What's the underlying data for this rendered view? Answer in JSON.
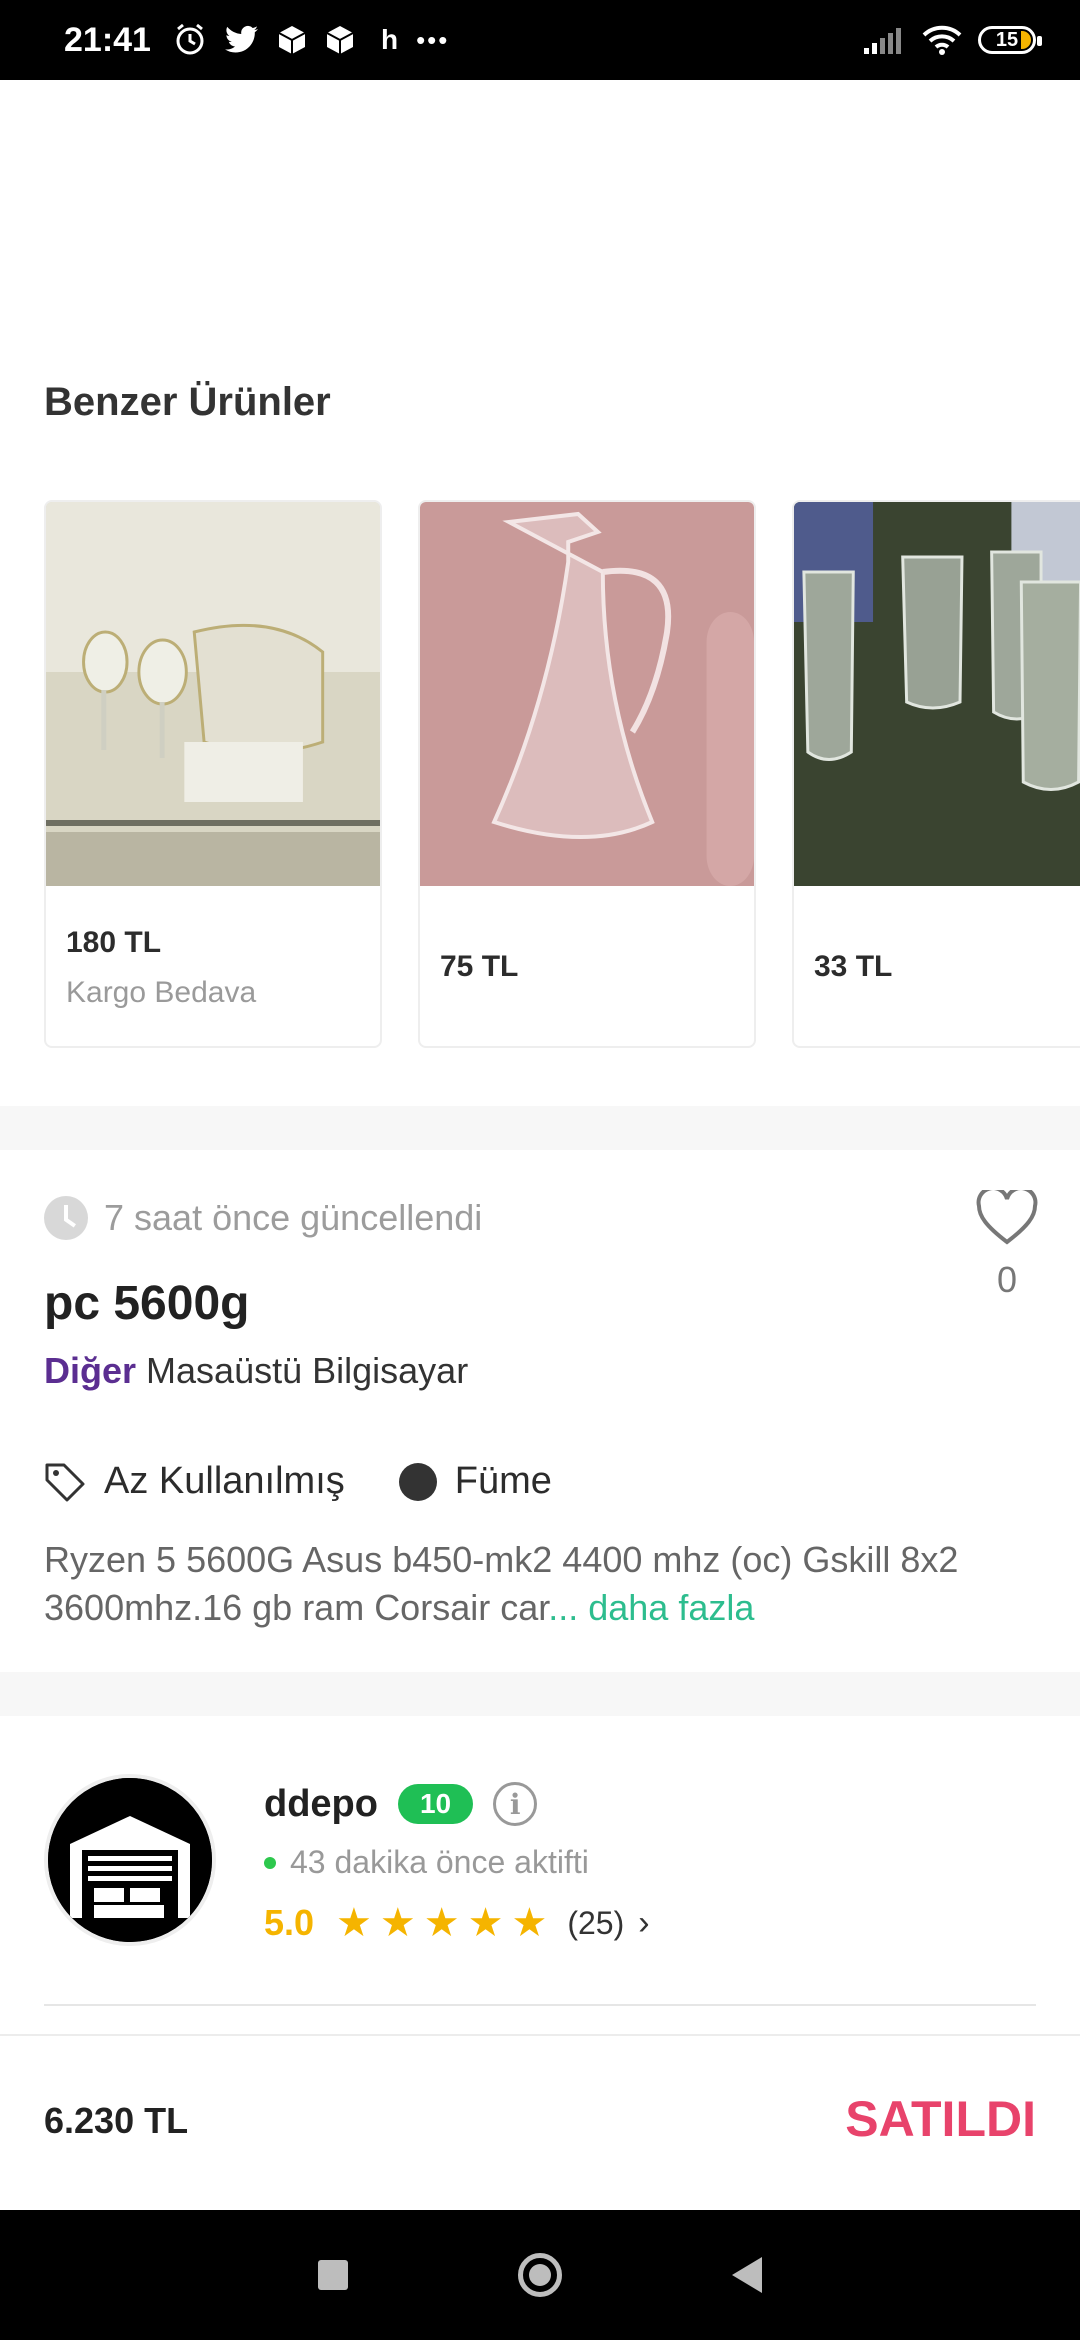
{
  "status_bar": {
    "time": "21:41",
    "extra_label": "h",
    "more_dots": "•••",
    "battery": "15"
  },
  "similar": {
    "title": "Benzer Ürünler",
    "items": [
      {
        "price": "180 TL",
        "subtitle": "Kargo Bedava"
      },
      {
        "price": "75 TL",
        "subtitle": ""
      },
      {
        "price": "33 TL",
        "subtitle": ""
      }
    ]
  },
  "listing": {
    "updated": "7 saat önce güncellendi",
    "likes": "0",
    "title": "pc 5600g",
    "category_main": "Diğer",
    "category_sub": "Masaüstü Bilgisayar",
    "condition": "Az Kullanılmış",
    "color": "Füme",
    "description": "Ryzen 5 5600G Asus b450-mk2 4400 mhz (oc) Gskill 8x2 3600mhz.16 gb ram Corsair car",
    "more_link": "... daha fazla"
  },
  "seller": {
    "name": "ddepo",
    "badge": "10",
    "info_symbol": "i",
    "last_active": "43 dakika önce aktifti",
    "rating": "5.0",
    "stars": 5,
    "review_count": "(25)"
  },
  "bottom": {
    "price": "6.230 TL",
    "status": "SATILDI"
  },
  "colors": {
    "accent_purple": "#5b2e91",
    "link_green": "#2dbd8e",
    "sold_pink": "#e8436b",
    "star_yellow": "#f5b400",
    "badge_green": "#1fbf55"
  }
}
